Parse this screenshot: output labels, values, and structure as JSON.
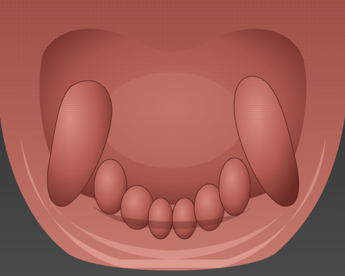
{
  "viewport": {
    "background_top": "#2e2e2e",
    "background_bottom": "#474747",
    "material_base": "#a9564c",
    "material_highlight": "#d98a80",
    "material_shadow": "#5c2621",
    "wireframe_color": "#b86a60"
  },
  "model": {
    "icon": "sculpt-mesh-icon"
  }
}
